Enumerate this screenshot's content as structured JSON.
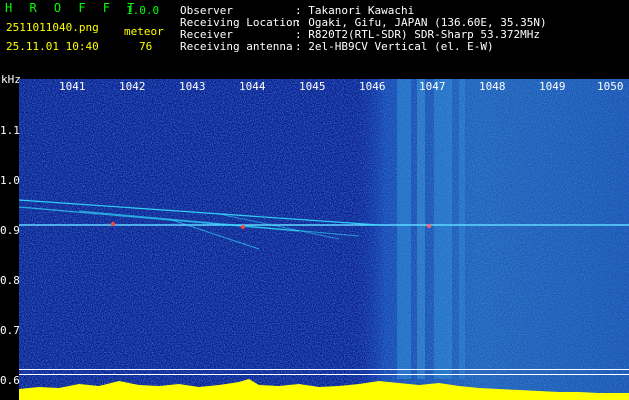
{
  "header": {
    "brand": "H R O F F T",
    "version": "1.0.0",
    "filename": "2511011040.png",
    "meteor_label": "meteor",
    "datetime": "25.11.01 10:40",
    "meteor_count": "76",
    "observer_label": "Observer",
    "observer_value": ": Takanori Kawachi",
    "location_label": "Receiving Location",
    "location_value": ": Ogaki, Gifu, JAPAN (136.60E, 35.35N)",
    "receiver_label": "Receiver",
    "receiver_value": ": R820T2(RTL-SDR) SDR-Sharp 53.372MHz",
    "antenna_label": "Receiving antenna",
    "antenna_value": ": 2el-HB9CV Vertical (el. E-W)"
  },
  "axes": {
    "y_unit": "kHz",
    "y_ticks": [
      "1.1",
      "1.0",
      "0.9",
      "0.8",
      "0.7",
      "0.6"
    ],
    "x_ticks": [
      "1041",
      "1042",
      "1043",
      "1044",
      "1045",
      "1046",
      "1047",
      "1048",
      "1049",
      "1050"
    ]
  },
  "colors": {
    "header_green": "#00ff00",
    "header_yellow": "#ffff00",
    "spectrum_bg": "#0a1a8a",
    "trace_cyan": "#33e0ff",
    "level_yellow": "#ffff00"
  }
}
